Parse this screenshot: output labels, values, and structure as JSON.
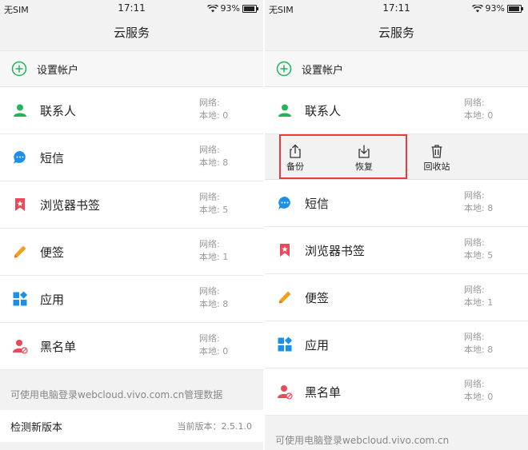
{
  "status": {
    "carrier": "无SIM",
    "time": "17:11",
    "battery": "93%"
  },
  "title": "云服务",
  "setup_account": "设置帐户",
  "labels": {
    "network": "网络:",
    "local": "本地:"
  },
  "items": [
    {
      "name": "联系人",
      "icon": "contact-icon",
      "local": "0"
    },
    {
      "name": "短信",
      "icon": "sms-icon",
      "local": "8"
    },
    {
      "name": "浏览器书签",
      "icon": "bookmark-icon",
      "local": "5"
    },
    {
      "name": "便签",
      "icon": "pencil-icon",
      "local": "1"
    },
    {
      "name": "应用",
      "icon": "apps-icon",
      "local": "8"
    },
    {
      "name": "黑名单",
      "icon": "blacklist-icon",
      "local": "0"
    }
  ],
  "footer_note": "可使用电脑登录webcloud.vivo.com.cn管理数据",
  "footer_note_truncated": "可使用电脑登录webcloud.vivo.com.cn",
  "check_update": {
    "label": "检测新版本",
    "version": "当前版本：2.5.1.0"
  },
  "actions": [
    {
      "label": "备份",
      "icon": "upload-icon"
    },
    {
      "label": "恢复",
      "icon": "download-icon"
    },
    {
      "label": "回收站",
      "icon": "trash-icon"
    }
  ],
  "colors": {
    "green": "#23b35a",
    "blue": "#1c8fe6",
    "red": "#e84a5a",
    "orange": "#f0a020",
    "highlight": "#e83c3c"
  }
}
